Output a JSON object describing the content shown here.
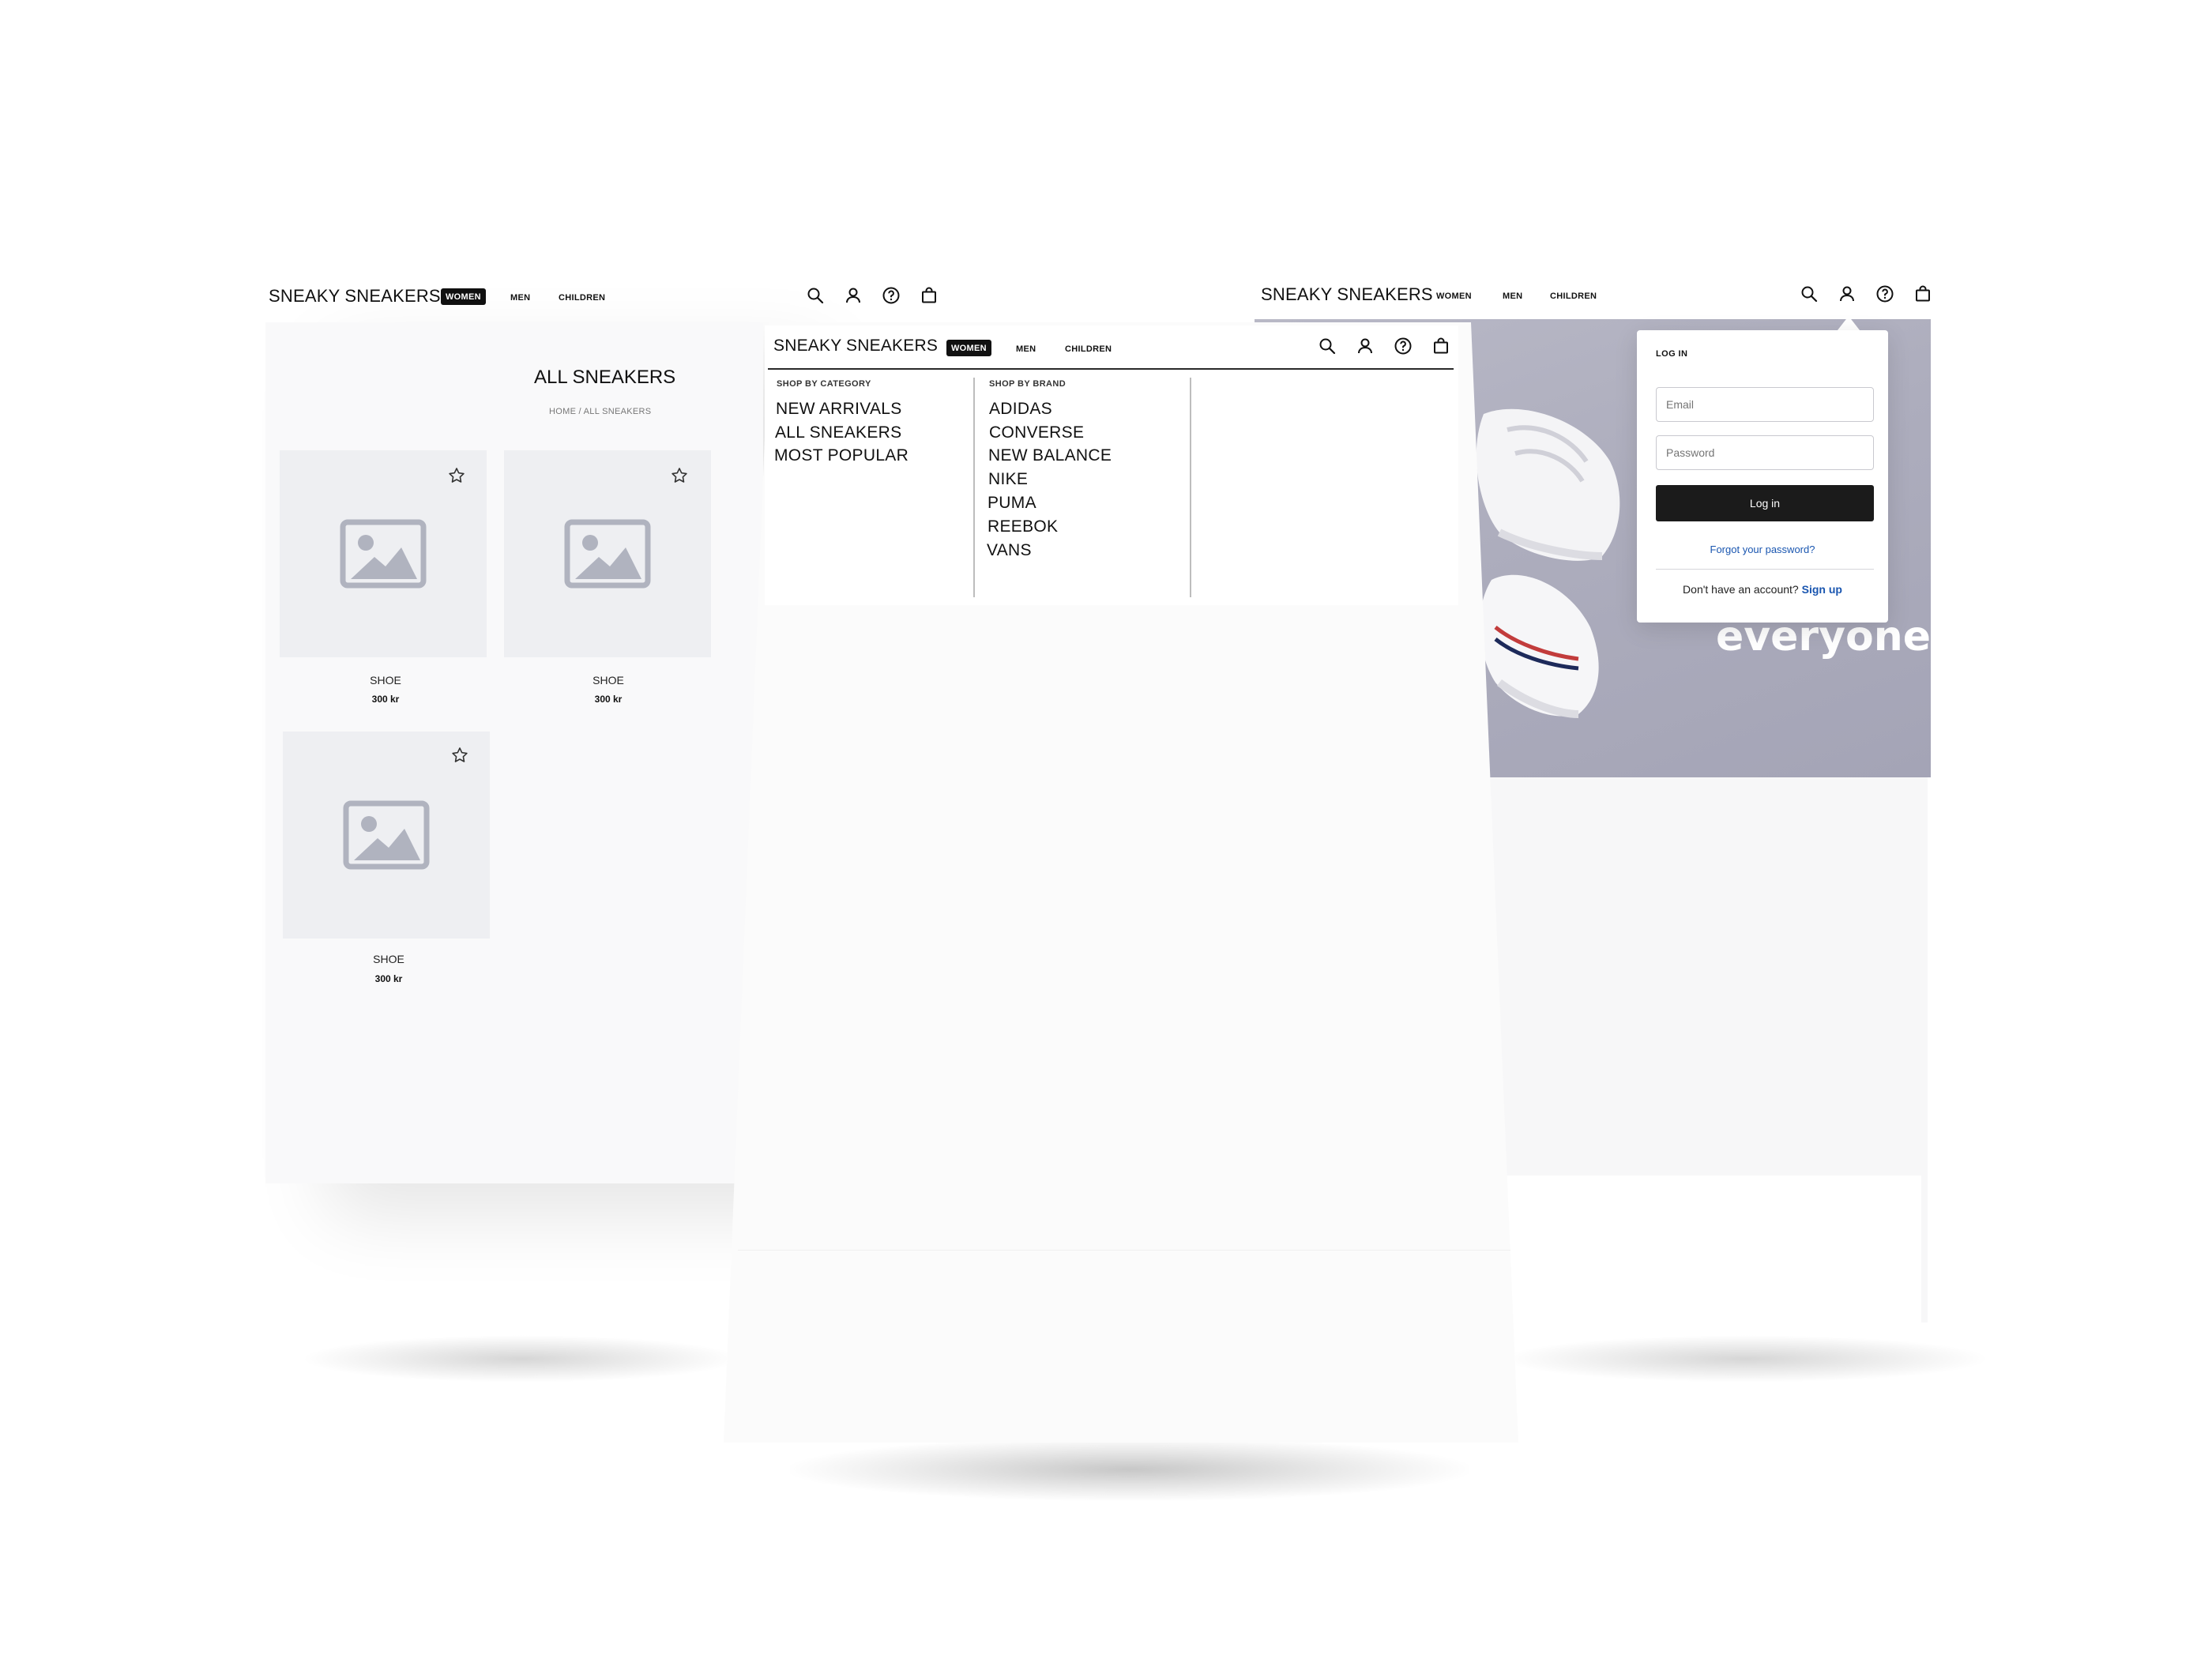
{
  "brand": "SNEAKY SNEAKERS",
  "nav": [
    "WOMEN",
    "MEN",
    "CHILDREN"
  ],
  "header_icons": [
    "search-icon",
    "user-icon",
    "help-icon",
    "bag-icon"
  ],
  "colors": {
    "accent": "#111111",
    "link": "#1a56b0",
    "placeholder": "#eeeff2",
    "hero": "#aeaebe"
  },
  "listing": {
    "title": "ALL SNEAKERS",
    "breadcrumb": "HOME / ALL SNEAKERS",
    "products": [
      {
        "name": "SHOE",
        "price": "300 kr"
      },
      {
        "name": "SHOE",
        "price": "300 kr"
      },
      {
        "name": "SHOE",
        "price": "300 kr"
      }
    ]
  },
  "menu": {
    "category_heading": "SHOP BY CATEGORY",
    "categories": [
      "NEW ARRIVALS",
      "ALL SNEAKERS",
      "MOST POPULAR"
    ],
    "brand_heading": "SHOP BY BRAND",
    "brands": [
      "ADIDAS",
      "CONVERSE",
      "NEW BALANCE",
      "NIKE",
      "PUMA",
      "REEBOK",
      "VANS"
    ]
  },
  "hero": {
    "headline_fragment": "everyone"
  },
  "login": {
    "title": "LOG IN",
    "email_placeholder": "Email",
    "password_placeholder": "Password",
    "submit_label": "Log in",
    "forgot_label": "Forgot your password?",
    "signup_prompt": "Don't have an account?",
    "signup_label": "Sign up"
  }
}
